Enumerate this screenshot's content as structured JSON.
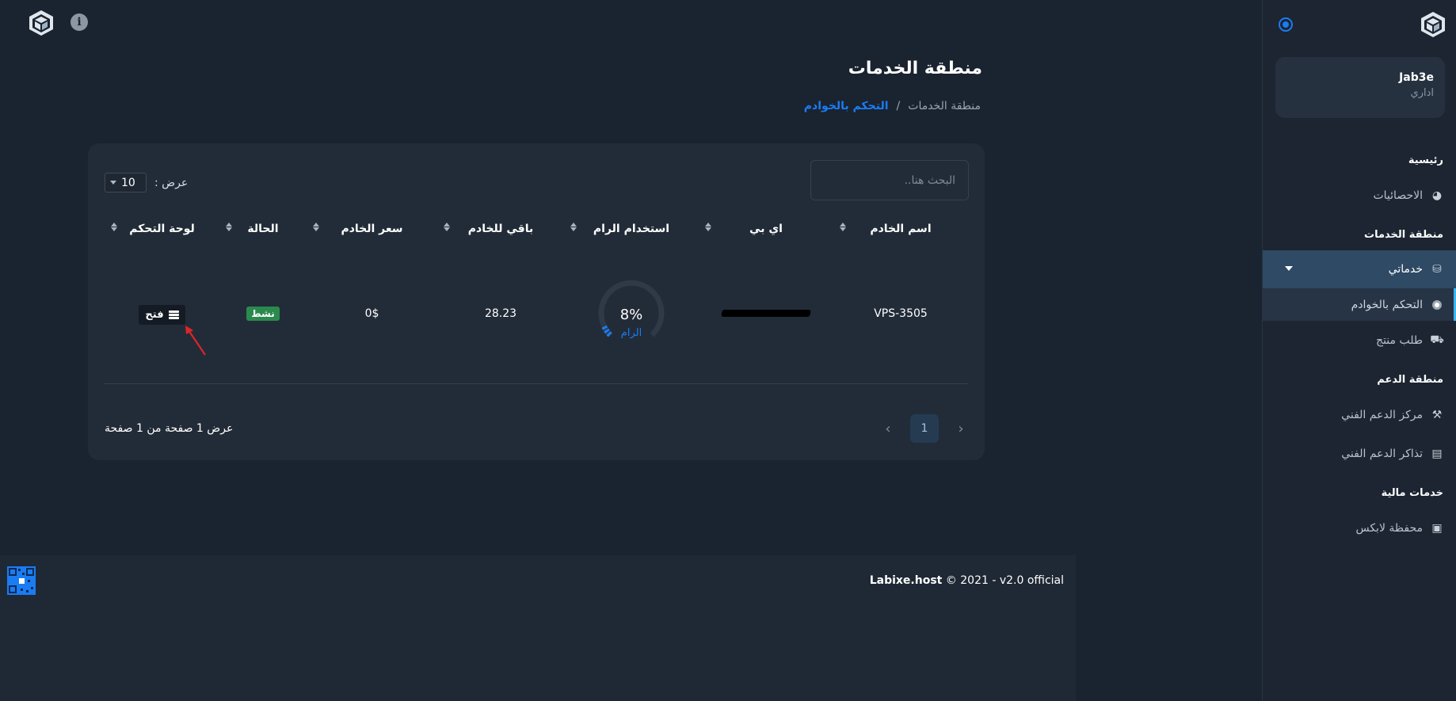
{
  "topbar": {
    "info_icon": "info-icon",
    "logo_icon": "cube-logo-icon"
  },
  "sidebar": {
    "user": {
      "name": "Jab3e",
      "role": "اداري"
    },
    "sections": {
      "home": "رئيسية",
      "stats": "الاحصائيات",
      "services_area": "منطقة الخدمات",
      "my_services": "خدماتي",
      "server_control": "التحكم بالخوادم",
      "order_product": "طلب منتج",
      "support_area": "منطقة الدعم",
      "support_center": "مركز الدعم الفني",
      "support_tickets": "تذاكر الدعم الفني",
      "financial": "خدمات مالية",
      "wallet": "محفظة لابكس"
    }
  },
  "page": {
    "title": "منطقة الخدمات",
    "breadcrumb": {
      "home": "منطقة الخدمات",
      "separator": "/",
      "current": "التحكم بالخوادم"
    }
  },
  "table_controls": {
    "search_placeholder": "البحث هنا..",
    "show_label": ": عرض",
    "page_size": "10"
  },
  "table": {
    "headers": [
      "اسم الخادم",
      "اي بي",
      "استخدام الرام",
      "باقي للخادم",
      "سعر الخادم",
      "الحالة",
      "لوحة التحكم"
    ],
    "row": {
      "name": "VPS-3505",
      "ram_percent": "8%",
      "ram_percent_value": 8,
      "ram_label": "الرام",
      "remaining": "28.23",
      "price": "0$",
      "status": "نشط",
      "open_label": "فتح"
    }
  },
  "pagination": {
    "info": "عرض 1 صفحة من 1 صفحة",
    "current_page": "1",
    "prev": "‹",
    "next": "›"
  },
  "footer": {
    "brand": "Labixe.host",
    "text": " © 2021 - v2.0 official"
  },
  "colors": {
    "accent": "#1a7cf3",
    "status_active": "#2a8a4e",
    "background": "#1a2330",
    "card": "#222c38"
  }
}
